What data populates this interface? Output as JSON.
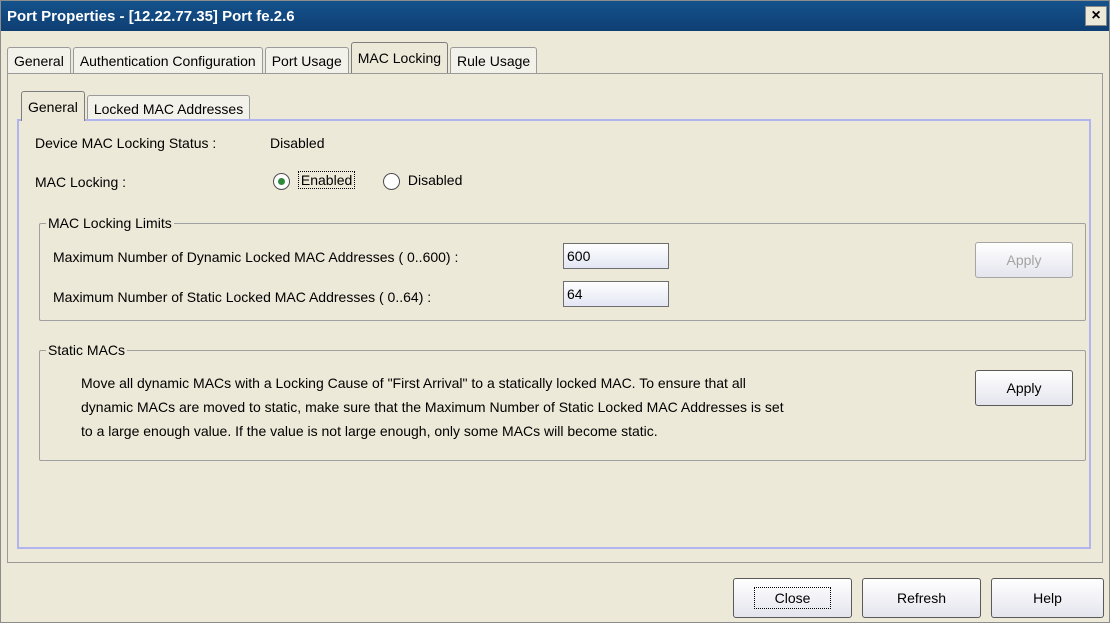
{
  "window": {
    "title": "Port Properties - [12.22.77.35] Port fe.2.6",
    "close_glyph": "×"
  },
  "outer_tabs": [
    {
      "label": "General"
    },
    {
      "label": "Authentication Configuration"
    },
    {
      "label": "Port Usage"
    },
    {
      "label": "MAC Locking",
      "active": true
    },
    {
      "label": "Rule Usage"
    }
  ],
  "inner_tabs": [
    {
      "label": "General",
      "active": true
    },
    {
      "label": "Locked MAC Addresses"
    }
  ],
  "status": {
    "label": "Device MAC Locking Status :",
    "value": "Disabled"
  },
  "mac_locking": {
    "label": "MAC Locking :",
    "options": [
      "Enabled",
      "Disabled"
    ],
    "selected": "Enabled"
  },
  "limits": {
    "title": "MAC Locking Limits",
    "dynamic_label": "Maximum Number of Dynamic Locked MAC Addresses ( 0..600) :",
    "dynamic_value": "600",
    "static_label": "Maximum Number of Static Locked MAC Addresses ( 0..64) :",
    "static_value": "64",
    "apply_label": "Apply"
  },
  "static_macs": {
    "title": "Static MACs",
    "line1": "Move all dynamic MACs with a Locking Cause of \"First Arrival\" to a statically locked MAC. To ensure that all",
    "line2": "dynamic MACs are moved to static, make sure that the Maximum Number of Static Locked MAC Addresses is set",
    "line3": "to a large enough value. If the value is not large enough, only some MACs will become static.",
    "apply_label": "Apply"
  },
  "footer": {
    "close_label": "Close",
    "refresh_label": "Refresh",
    "help_label": "Help"
  }
}
